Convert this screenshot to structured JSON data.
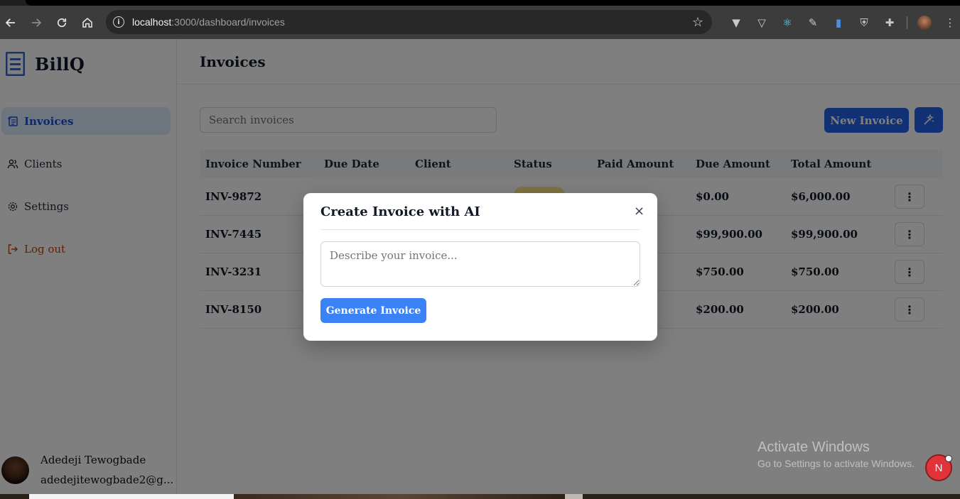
{
  "browser": {
    "url_host": "localhost",
    "url_path": ":3000/dashboard/invoices"
  },
  "app": {
    "brand": "BillQ",
    "page_title": "Invoices"
  },
  "sidebar": {
    "items": [
      {
        "label": "Invoices",
        "icon": "invoice-icon",
        "active": true
      },
      {
        "label": "Clients",
        "icon": "users-icon"
      },
      {
        "label": "Settings",
        "icon": "gear-icon"
      },
      {
        "label": "Log out",
        "icon": "logout-icon"
      }
    ],
    "user": {
      "name": "Adedeji Tewogbade",
      "email": "adedejitewogbade2@g..."
    }
  },
  "toolbar": {
    "search_placeholder": "Search invoices",
    "new_invoice_label": "New Invoice"
  },
  "table": {
    "columns": [
      "Invoice Number",
      "Due Date",
      "Client",
      "Status",
      "Paid Amount",
      "Due Amount",
      "Total Amount"
    ],
    "rows": [
      {
        "invoice_number": "INV-9872",
        "due_amount": "$0.00",
        "total_amount": "$6,000.00"
      },
      {
        "invoice_number": "INV-7445",
        "due_amount": "$99,900.00",
        "total_amount": "$99,900.00"
      },
      {
        "invoice_number": "INV-3231",
        "due_amount": "$750.00",
        "total_amount": "$750.00"
      },
      {
        "invoice_number": "INV-8150",
        "due_amount": "$200.00",
        "total_amount": "$200.00"
      }
    ],
    "row_action_icon": "⋮"
  },
  "modal": {
    "title": "Create Invoice with AI",
    "close_icon": "×",
    "textarea_placeholder": "Describe your invoice...",
    "button_label": "Generate Invoice"
  },
  "watermark": {
    "line1": "Activate Windows",
    "line2": "Go to Settings to activate Windows."
  },
  "next_badge": "N",
  "colors": {
    "primary": "#2563eb",
    "modal_button": "#3b82f6",
    "active_bg": "#dbeafe",
    "logout": "#c2410c"
  }
}
